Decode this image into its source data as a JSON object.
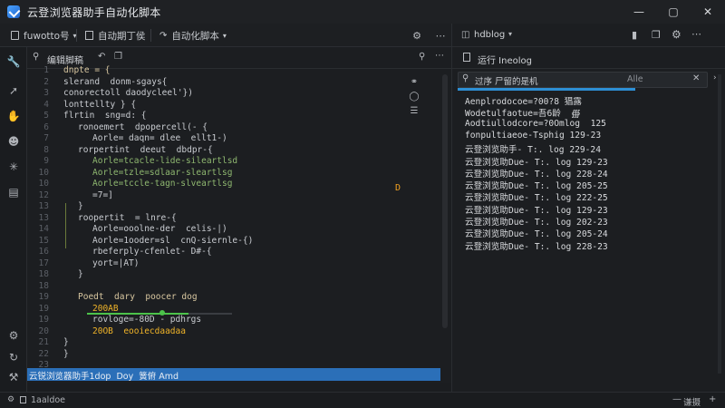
{
  "window": {
    "title": "云登浏览器助手自动化脚本",
    "controls": [
      "minimize",
      "maximize",
      "close"
    ]
  },
  "toolbar": {
    "items": [
      {
        "icon": "file-icon",
        "label": "fuwotto号",
        "dropdown": true
      },
      {
        "icon": "doc-icon",
        "label": "自动期丁侯",
        "dropdown": false
      },
      {
        "icon": "script-icon",
        "label": "自动化脚本",
        "dropdown": true
      }
    ],
    "right_icons": [
      "gear-icon",
      "more-icon"
    ]
  },
  "activitybar": {
    "top_icons": [
      "wrench-icon",
      "run-icon",
      "hand-icon",
      "user-icon",
      "loading-icon",
      "panel-icon"
    ],
    "bottom_icons": [
      "settings-gear-icon",
      "refresh-icon",
      "wrench-small-icon"
    ]
  },
  "editor": {
    "tab_label": "编辑脚稿",
    "tab_icons": [
      "pin-icon",
      "back-icon",
      "copy-icon"
    ],
    "right_icons": [
      "bell-icon",
      "more-icon"
    ],
    "lines": [
      {
        "n": "1",
        "text": "dnpte = {",
        "indent": 0,
        "color": "#d8c7a0"
      },
      {
        "n": "2",
        "text": "slerand  donm-sgays{",
        "indent": 0,
        "color": "#c9ccd1"
      },
      {
        "n": "3",
        "text": "conorectoll daodycleel'})",
        "indent": 0,
        "color": "#c9ccd1"
      },
      {
        "n": "4",
        "text": "lonttellty } {",
        "indent": 0,
        "color": "#c9ccd1"
      },
      {
        "n": "5",
        "text": "flrtin  sng=d: {",
        "indent": 0,
        "color": "#c9ccd1"
      },
      {
        "n": "6",
        "text": "ronoemert  dpopercell(- {",
        "indent": 1,
        "color": "#c9ccd1"
      },
      {
        "n": "7",
        "text": "Aorle= daqn= dlee  ellt1-)",
        "indent": 2,
        "color": "#c9ccd1"
      },
      {
        "n": "8",
        "text": "rorpertint  deeut  dbdpr-{",
        "indent": 1,
        "color": "#c9ccd1"
      },
      {
        "n": "9",
        "text": "Aorle=tcacle-lide-sileartlsd",
        "indent": 2,
        "color": "#8fb870"
      },
      {
        "n": "10",
        "text": "Aorle=tzle=sdlaar-sleartlsg",
        "indent": 2,
        "color": "#8fb870"
      },
      {
        "n": "10",
        "text": "Aorle=tccle-tagn-slveartlsg",
        "indent": 2,
        "color": "#8fb870"
      },
      {
        "n": "12",
        "text": "=7=]",
        "indent": 2,
        "color": "#c9ccd1"
      },
      {
        "n": "13",
        "text": "}",
        "indent": 1,
        "color": "#c9ccd1"
      },
      {
        "n": "13",
        "text": "roopertit  = lnre-{",
        "indent": 1,
        "color": "#c9ccd1"
      },
      {
        "n": "14",
        "text": "Aorle=ooolne-der  celis-|)",
        "indent": 2,
        "color": "#c9ccd1"
      },
      {
        "n": "15",
        "text": "Aorle=1ooder=sl  cnQ-siernle-{)",
        "indent": 2,
        "color": "#c9ccd1"
      },
      {
        "n": "16",
        "text": "rbeferply-cfenlet- D#-{",
        "indent": 2,
        "color": "#c9ccd1"
      },
      {
        "n": "17",
        "text": "yort=|AT)",
        "indent": 2,
        "color": "#c9ccd1"
      },
      {
        "n": "18",
        "text": "}",
        "indent": 1,
        "color": "#c9ccd1"
      },
      {
        "n": "18",
        "text": "",
        "indent": 0,
        "color": "#c9ccd1"
      },
      {
        "n": "19",
        "text": "Poedt  dary  poocer dog",
        "indent": 1,
        "color": "#d8c7a0"
      },
      {
        "n": "19",
        "text": "200AB",
        "indent": 2,
        "color": "#f0b429"
      },
      {
        "n": "19",
        "text": "rovloge=-80D - pdhrgs",
        "indent": 2,
        "color": "#c9ccd1"
      },
      {
        "n": "20",
        "text": "20OB  eooiecdaadaa",
        "indent": 2,
        "color": "#f0b429"
      },
      {
        "n": "21",
        "text": "}",
        "indent": 0,
        "color": "#c9ccd1"
      },
      {
        "n": "22",
        "text": "}",
        "indent": 0,
        "color": "#c9ccd1"
      },
      {
        "n": "23",
        "text": "",
        "indent": 0,
        "color": "#c9ccd1"
      }
    ],
    "marker_text": "D",
    "selected_line_text": "云锐浏览器助手1dop  Doy  簧俯 Amd"
  },
  "log_panel": {
    "tab_label": "hdblog",
    "tab_icons": [
      "log-tab-icon",
      "chat-icon",
      "copy-icon",
      "settings-gear-icon",
      "more-icon"
    ],
    "sub_label": "运行 Ineolog",
    "search_placeholder": "过序  尸留的是机",
    "search_filter": "Alle",
    "lines": [
      "Aenplrodocoe=?00?8 猖露",
      "Wodetulfaotue=吾6龄  ∰",
      "Aodtiullodcore=?0Omlog  125",
      "fonpultiaeoe-Tsphig 129-23",
      "云登浏览助手- T:. log 229-24",
      "云登浏览助Due- T:. log 129-23",
      "云登浏览助Due- T:. log 228-24",
      "云登浏览助Due- T:. log 205-25",
      "云登浏览助Due- T:. log 222-25",
      "云登浏览助Due- T:. log 129-23",
      "云登浏览助Due- T:. log 202-23",
      "云登浏览助Due- T:. log 205-24",
      "云登浏览助Due- T:. log 228-23"
    ]
  },
  "statusbar": {
    "left_text": "1aaldoe",
    "right_text": "谦摄"
  },
  "colors": {
    "accent": "#2d8fd5",
    "selection": "#2b6fb8",
    "background": "#1c1e21"
  }
}
